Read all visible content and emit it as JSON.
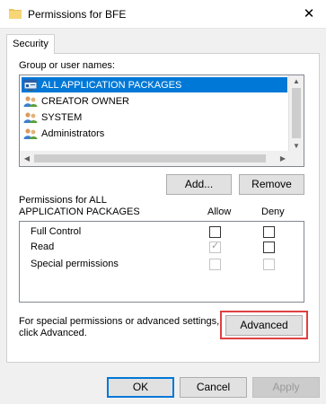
{
  "window": {
    "title": "Permissions for BFE",
    "close_glyph": "✕"
  },
  "tabs": [
    {
      "label": "Security"
    }
  ],
  "group_section": {
    "label": "Group or user names:",
    "users": [
      {
        "name": "ALL APPLICATION PACKAGES",
        "selected": true,
        "icon": "app-packages-icon"
      },
      {
        "name": "CREATOR OWNER",
        "selected": false,
        "icon": "user-group-icon"
      },
      {
        "name": "SYSTEM",
        "selected": false,
        "icon": "user-group-icon"
      },
      {
        "name": "Administrators",
        "selected": false,
        "icon": "user-group-icon"
      }
    ],
    "add_button": "Add...",
    "remove_button": "Remove"
  },
  "permissions": {
    "header_line1": "Permissions for ALL",
    "header_line2": "APPLICATION PACKAGES",
    "allow_label": "Allow",
    "deny_label": "Deny",
    "rows": [
      {
        "name": "Full Control",
        "allow": false,
        "deny": false,
        "allow_disabled": false,
        "deny_disabled": false
      },
      {
        "name": "Read",
        "allow": true,
        "deny": false,
        "allow_disabled": true,
        "deny_disabled": false
      },
      {
        "name": "Special permissions",
        "allow": false,
        "deny": false,
        "allow_disabled": true,
        "deny_disabled": true
      }
    ]
  },
  "advanced_section": {
    "text_line1": "For special permissions or advanced settings,",
    "text_line2": "click Advanced.",
    "button": "Advanced"
  },
  "footer": {
    "ok": "OK",
    "cancel": "Cancel",
    "apply": "Apply"
  },
  "colors": {
    "selection": "#0078d7",
    "highlight_box": "#e04040",
    "dialog_bg": "#f0f0f0"
  }
}
